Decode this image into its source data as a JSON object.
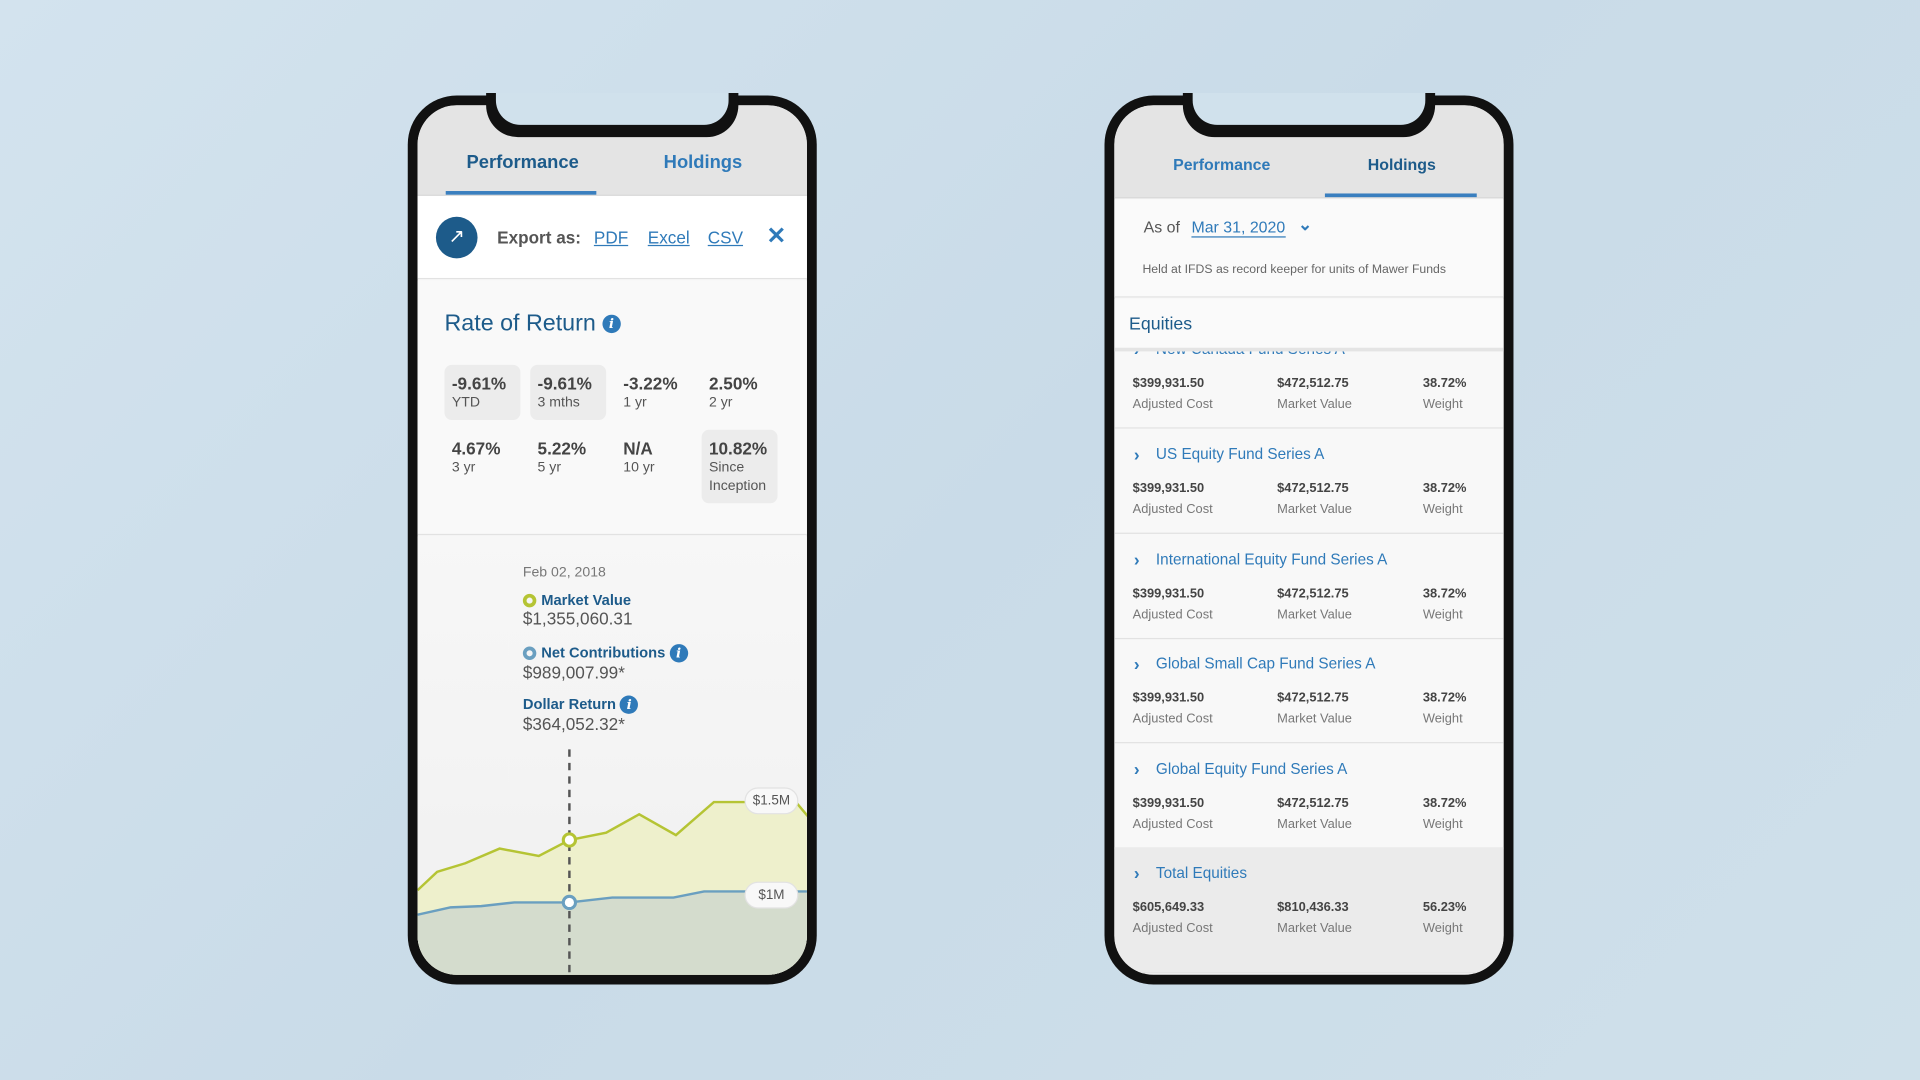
{
  "left_phone": {
    "tabs": [
      {
        "label": "Performance",
        "active": true
      },
      {
        "label": "Holdings",
        "active": false
      }
    ],
    "export": {
      "label": "Export as:",
      "options": [
        "PDF",
        "Excel",
        "CSV"
      ],
      "icon": "external-link-icon",
      "close_icon": "close-icon"
    },
    "rate_of_return": {
      "title": "Rate of Return",
      "items": [
        {
          "value": "-9.61%",
          "period": "YTD"
        },
        {
          "value": "-9.61%",
          "period": "3 mths"
        },
        {
          "value": "-3.22%",
          "period": "1 yr"
        },
        {
          "value": "2.50%",
          "period": "2 yr"
        },
        {
          "value": "4.67%",
          "period": "3 yr"
        },
        {
          "value": "5.22%",
          "period": "5 yr"
        },
        {
          "value": "N/A",
          "period": "10 yr"
        },
        {
          "value": "10.82%",
          "period": "Since Inception"
        }
      ]
    },
    "tooltip": {
      "date": "Feb 02, 2018",
      "market_value_label": "Market Value",
      "market_value": "$1,355,060.31",
      "net_contributions_label": "Net Contributions",
      "net_contributions": "$989,007.99*",
      "dollar_return_label": "Dollar Return",
      "dollar_return": "$364,052.32*"
    },
    "chart": {
      "y_labels": [
        "$1.5M",
        "$1M"
      ],
      "colors": {
        "market_value": "#b5c434",
        "net_contributions": "#6a9fc0"
      }
    }
  },
  "right_phone": {
    "tabs": [
      {
        "label": "Performance",
        "active": false
      },
      {
        "label": "Holdings",
        "active": true
      }
    ],
    "as_of_label": "As of",
    "as_of_date": "Mar 31, 2020",
    "note": "Held at IFDS as record keeper for units of Mawer Funds",
    "section": "Equities",
    "col_labels": {
      "cost": "Adjusted Cost",
      "value": "Market Value",
      "weight": "Weight"
    },
    "funds": [
      {
        "name": "New Canada Fund Series A",
        "cost": "$399,931.50",
        "value": "$472,512.75",
        "weight": "38.72%"
      },
      {
        "name": "US Equity Fund Series A",
        "cost": "$399,931.50",
        "value": "$472,512.75",
        "weight": "38.72%"
      },
      {
        "name": "International Equity Fund Series A",
        "cost": "$399,931.50",
        "value": "$472,512.75",
        "weight": "38.72%"
      },
      {
        "name": "Global Small Cap Fund Series A",
        "cost": "$399,931.50",
        "value": "$472,512.75",
        "weight": "38.72%"
      },
      {
        "name": "Global Equity Fund Series A",
        "cost": "$399,931.50",
        "value": "$472,512.75",
        "weight": "38.72%"
      },
      {
        "name": "Total Equities",
        "cost": "$605,649.33",
        "value": "$810,436.33",
        "weight": "56.23%"
      }
    ]
  }
}
